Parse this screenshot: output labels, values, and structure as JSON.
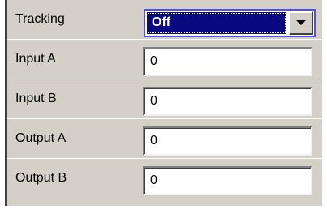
{
  "tracking": {
    "label": "Tracking",
    "selected": "Off"
  },
  "fields": [
    {
      "label": "Input A",
      "value": "0"
    },
    {
      "label": "Input B",
      "value": "0"
    },
    {
      "label": "Output A",
      "value": "0"
    },
    {
      "label": "Output B",
      "value": "0"
    }
  ],
  "colors": {
    "panel_bg": "#d4d0c8",
    "selection_bg": "#0a0a80",
    "focus_border": "#5050e8"
  },
  "icons": {
    "dropdown": "chevron-down-icon"
  }
}
